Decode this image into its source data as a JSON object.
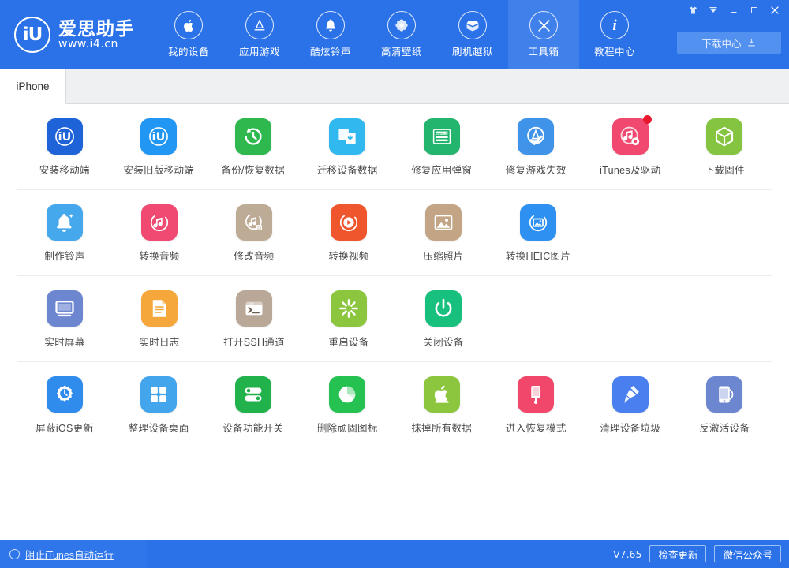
{
  "header": {
    "brand": {
      "logo_text": "iU",
      "name": "爱思助手",
      "url": "www.i4.cn"
    },
    "nav": [
      {
        "label": "我的设备",
        "icon": "apple-icon",
        "active": false
      },
      {
        "label": "应用游戏",
        "icon": "appstore-icon",
        "active": false
      },
      {
        "label": "酷炫铃声",
        "icon": "bell-icon",
        "active": false
      },
      {
        "label": "高清壁纸",
        "icon": "flower-icon",
        "active": false
      },
      {
        "label": "刷机越狱",
        "icon": "box-open-icon",
        "active": false
      },
      {
        "label": "工具箱",
        "icon": "tools-icon",
        "active": true
      },
      {
        "label": "教程中心",
        "icon": "info-icon",
        "active": false
      }
    ],
    "window_controls": [
      {
        "name": "shirt-icon",
        "glyph": "👕"
      },
      {
        "name": "chevron-down-icon",
        "glyph": "▾"
      },
      {
        "name": "minimize-icon",
        "glyph": "—"
      },
      {
        "name": "maximize-icon",
        "glyph": "▫"
      },
      {
        "name": "close-icon",
        "glyph": "✕"
      }
    ],
    "download_center": {
      "label": "下载中心",
      "icon": "download-icon"
    }
  },
  "tabs": [
    {
      "label": "iPhone",
      "active": true
    }
  ],
  "toolbox": {
    "rows": [
      {
        "tools": [
          {
            "label": "安装移动端",
            "icon": "i4-app-icon",
            "color": "#1f63d8",
            "badge": false
          },
          {
            "label": "安装旧版移动端",
            "icon": "i4-app-legacy-icon",
            "color": "#2196f3",
            "badge": false
          },
          {
            "label": "备份/恢复数据",
            "icon": "backup-restore-icon",
            "color": "#2eb84e",
            "badge": false
          },
          {
            "label": "迁移设备数据",
            "icon": "migrate-data-icon",
            "color": "#30b8ef",
            "badge": false
          },
          {
            "label": "修复应用弹窗",
            "icon": "appleid-popup-icon",
            "color": "#23b56d",
            "badge": false
          },
          {
            "label": "修复游戏失效",
            "icon": "fix-game-icon",
            "color": "#3f93e8",
            "badge": false
          },
          {
            "label": "iTunes及驱动",
            "icon": "itunes-driver-icon",
            "color": "#f0486f",
            "badge": true
          },
          {
            "label": "下载固件",
            "icon": "firmware-box-icon",
            "color": "#84c440",
            "badge": false
          }
        ]
      },
      {
        "tools": [
          {
            "label": "制作铃声",
            "icon": "make-ringtone-icon",
            "color": "#45a7ec",
            "badge": false
          },
          {
            "label": "转换音频",
            "icon": "convert-audio-icon",
            "color": "#f04a72",
            "badge": false
          },
          {
            "label": "修改音频",
            "icon": "edit-audio-icon",
            "color": "#bdab96",
            "badge": false
          },
          {
            "label": "转换视频",
            "icon": "convert-video-icon",
            "color": "#f0562e",
            "badge": false
          },
          {
            "label": "压缩照片",
            "icon": "compress-photo-icon",
            "color": "#c3a586",
            "badge": false
          },
          {
            "label": "转换HEIC图片",
            "icon": "heic-convert-icon",
            "color": "#2e90f0",
            "badge": false
          }
        ]
      },
      {
        "tools": [
          {
            "label": "实时屏幕",
            "icon": "live-screen-icon",
            "color": "#6d86d0",
            "badge": false
          },
          {
            "label": "实时日志",
            "icon": "live-log-icon",
            "color": "#f5a73c",
            "badge": false
          },
          {
            "label": "打开SSH通道",
            "icon": "ssh-tunnel-icon",
            "color": "#b9a898",
            "badge": false
          },
          {
            "label": "重启设备",
            "icon": "restart-device-icon",
            "color": "#8cc63f",
            "badge": false
          },
          {
            "label": "关闭设备",
            "icon": "power-off-icon",
            "color": "#17c07c",
            "badge": false
          }
        ]
      },
      {
        "tools": [
          {
            "label": "屏蔽iOS更新",
            "icon": "block-ios-update-icon",
            "color": "#2f8ced",
            "badge": false
          },
          {
            "label": "整理设备桌面",
            "icon": "arrange-desktop-icon",
            "color": "#43a5ec",
            "badge": false
          },
          {
            "label": "设备功能开关",
            "icon": "feature-toggle-icon",
            "color": "#21b24b",
            "badge": false
          },
          {
            "label": "删除顽固图标",
            "icon": "delete-icon-icon",
            "color": "#25c151",
            "badge": false
          },
          {
            "label": "抹掉所有数据",
            "icon": "erase-all-data-icon",
            "color": "#8cc63f",
            "badge": false
          },
          {
            "label": "进入恢复模式",
            "icon": "recovery-mode-icon",
            "color": "#f0476b",
            "badge": false
          },
          {
            "label": "清理设备垃圾",
            "icon": "clean-junk-icon",
            "color": "#4a7ff0",
            "badge": false
          },
          {
            "label": "反激活设备",
            "icon": "deactivate-device-icon",
            "color": "#6d86d0",
            "badge": false
          }
        ]
      }
    ]
  },
  "footer": {
    "prevent_itunes_label": "阻止iTunes自动运行",
    "version": "V7.65",
    "check_update_label": "检查更新",
    "wechat_label": "微信公众号"
  },
  "colors": {
    "brand_blue": "#2b72e8",
    "nav_active": "#3f80ea",
    "badge_red": "#e8192c"
  }
}
